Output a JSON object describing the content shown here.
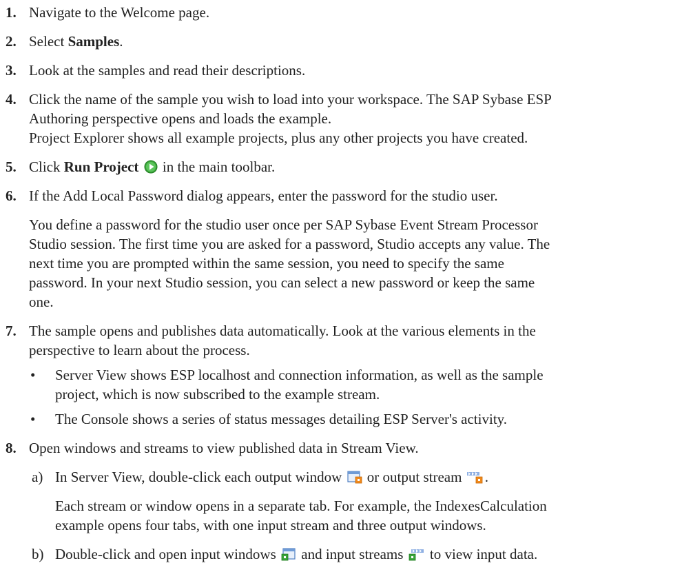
{
  "steps": [
    {
      "num": "1.",
      "text": "Navigate to the Welcome page."
    },
    {
      "num": "2.",
      "pre": "Select ",
      "bold": "Samples",
      "post": "."
    },
    {
      "num": "3.",
      "text": "Look at the samples and read their descriptions."
    },
    {
      "num": "4.",
      "line1": "Click the name of the sample you wish to load into your workspace. The SAP Sybase ESP",
      "line2": "Authoring perspective opens and loads the example.",
      "line3": "Project Explorer shows all example projects, plus any other projects you have created."
    },
    {
      "num": "5.",
      "pre": "Click ",
      "bold": "Run Project",
      "post": " in the main toolbar."
    },
    {
      "num": "6.",
      "text": "If the Add Local Password dialog appears, enter the password for the studio user.",
      "para1": "You define a password for the studio user once per SAP Sybase Event Stream Processor",
      "para2": "Studio session. The first time you are asked for a password, Studio accepts any value. The",
      "para3": "next time you are prompted within the same session, you need to specify the same",
      "para4": "password. In your next Studio session, you can select a new password or keep the same",
      "para5": "one."
    },
    {
      "num": "7.",
      "line1": "The sample opens and publishes data automatically. Look at the various elements in the",
      "line2": "perspective to learn about the process.",
      "bullet1a": "Server View shows ESP localhost and connection information, as well as the sample",
      "bullet1b": "project, which is now subscribed to the example stream.",
      "bullet2": "The Console shows a series of status messages detailing ESP Server's activity."
    },
    {
      "num": "8.",
      "text": "Open windows and streams to view published data in Stream View.",
      "a_label": "a)",
      "a_pre": "In Server View, double-click each output window",
      "a_mid": "or output stream",
      "a_post": ".",
      "a_p1": "Each stream or window opens in a separate tab. For example, the IndexesCalculation",
      "a_p2": "example opens four tabs, with one input stream and three output windows.",
      "b_label": "b)",
      "b_pre": "Double-click and open input windows",
      "b_mid": "and input streams",
      "b_post": "to view input data."
    }
  ],
  "bullet_char": "•",
  "icons": {
    "run": "run-project-icon",
    "output_window": "output-window-icon",
    "output_stream": "output-stream-icon",
    "input_window": "input-window-icon",
    "input_stream": "input-stream-icon"
  }
}
